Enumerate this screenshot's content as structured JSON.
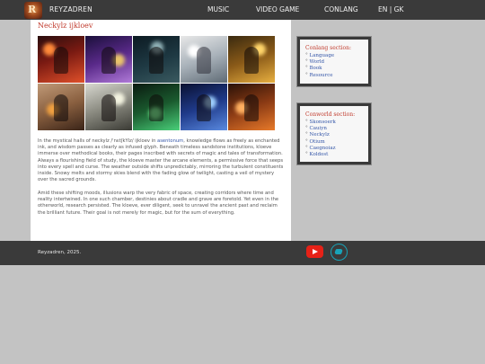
{
  "nav": {
    "brand": "REYZADREN",
    "items": [
      "MUSIC",
      "VIDEO GAME",
      "CONLANG",
      "EN | GK"
    ]
  },
  "main": {
    "title": "Neckylz ijkloev",
    "gallery_count": 10,
    "paragraph1": {
      "before": "In the mystical halls of neckylz /ˈnɛtʃkYlz/ ijkloev in ",
      "link": "asentonum",
      "after": ", knowledge flows as freely as enchanted ink, and wisdom passes as clearly as infused glyph. Beneath timeless sandstone institutions, kloeve immerse over methodical books, their pages inscribed with secrets of magic and tales of transformation. Always a flourishing field of study, the kloeve master the arcane elements, a permissive force that seeps into every spell and curse. The weather outside shifts unpredictably, mirroring the turbulent constituents inside. Snowy melts and stormy skies blend with the fading glow of twilight, casting a veil of mystery over the sacred grounds."
    },
    "paragraph2": "Amid these shifting moods, illusions warp the very fabric of space, creating corridors where time and reality intertwined. In one such chamber, destinies about cradle and grave are foretold. Yet even in the otherworld, research persisted. The kloeve, ever diligent, seek to unravel the ancient past and reclaim the brilliant future. Their goal is not merely for magic, but for the sum of everything."
  },
  "sidebar": {
    "conlang": {
      "title": "Conlang section:",
      "items": [
        "Language",
        "World",
        "Book",
        "Resource"
      ]
    },
    "conworld": {
      "title": "Conworld section:",
      "items": [
        "Skonsoerk",
        "Cauiyn",
        "Neckylz",
        "Otium",
        "Caegnoiaz",
        "Koldost"
      ]
    }
  },
  "footer": {
    "copyright": "Reyzadren, 2025.",
    "icons": [
      "youtube-icon",
      "bird-icon"
    ]
  },
  "colors": {
    "bar": "#3a3a3a",
    "accent": "#c0392b",
    "link": "#3456a8",
    "background": "#c3c3c3"
  }
}
